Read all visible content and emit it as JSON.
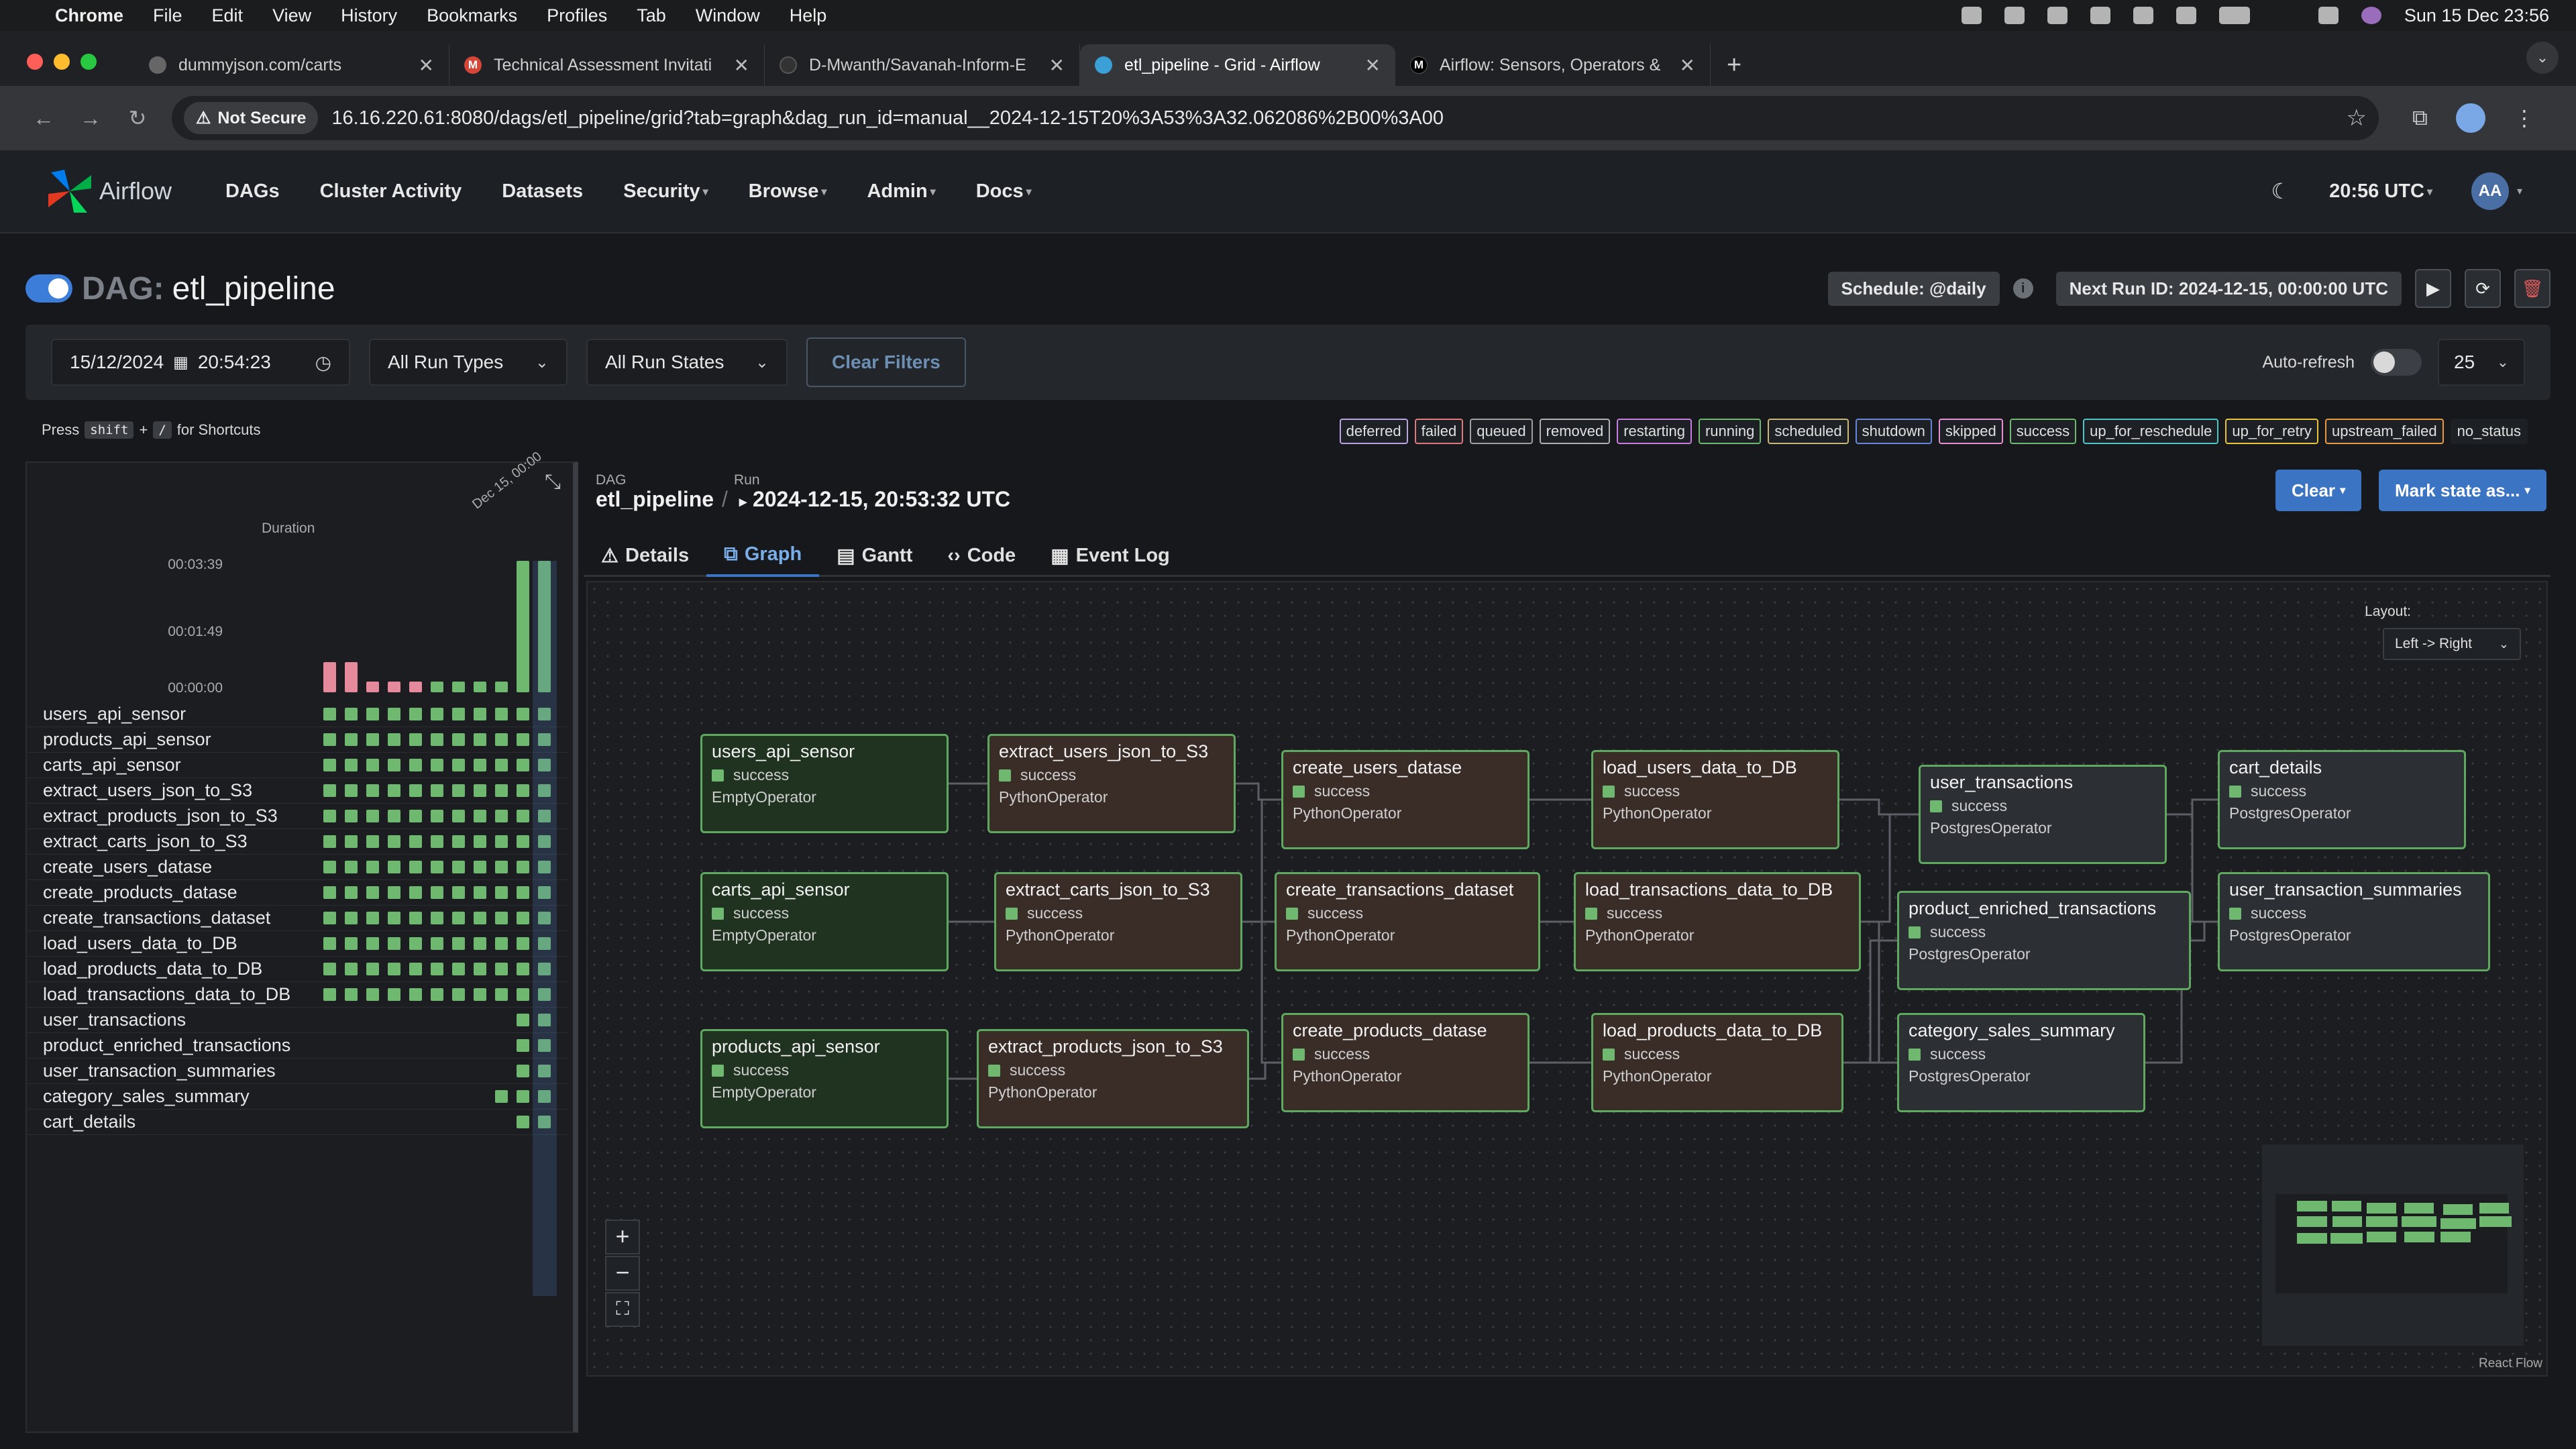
{
  "macbar": {
    "app": "Chrome",
    "menus": [
      "File",
      "Edit",
      "View",
      "History",
      "Bookmarks",
      "Profiles",
      "Tab",
      "Window",
      "Help"
    ],
    "clock": "Sun 15 Dec  23:56"
  },
  "tabs": [
    {
      "title": "dummyjson.com/carts",
      "icon": "globe-icon"
    },
    {
      "title": "Technical Assessment Invitati",
      "icon": "gmail-icon"
    },
    {
      "title": "D-Mwanth/Savanah-Inform-E",
      "icon": "github-icon"
    },
    {
      "title": "etl_pipeline - Grid - Airflow",
      "icon": "airflow-icon"
    },
    {
      "title": "Airflow: Sensors, Operators &",
      "icon": "medium-icon"
    }
  ],
  "address": {
    "security": "Not Secure",
    "url": "16.16.220.61:8080/dags/etl_pipeline/grid?tab=graph&dag_run_id=manual__2024-12-15T20%3A53%3A32.062086%2B00%3A00"
  },
  "nav": {
    "logo": "Airflow",
    "items": [
      "DAGs",
      "Cluster Activity",
      "Datasets",
      "Security",
      "Browse",
      "Admin",
      "Docs"
    ],
    "utc": "20:56 UTC",
    "avatar": "AA"
  },
  "dag": {
    "prefix": "DAG:",
    "name": "etl_pipeline",
    "schedule": "Schedule: @daily",
    "next_run": "Next Run ID: 2024-12-15, 00:00:00 UTC"
  },
  "filters": {
    "date": "15/12/2024",
    "time": "20:54:23",
    "run_types": "All Run Types",
    "run_states": "All Run States",
    "clear": "Clear Filters",
    "auto_refresh": "Auto-refresh",
    "page_size": "25"
  },
  "shortcuts": {
    "press": "Press",
    "key1": "shift",
    "plus": "+",
    "key2": "/",
    "suffix": "for Shortcuts"
  },
  "legend": [
    {
      "label": "deferred",
      "color": "#b9a3e3"
    },
    {
      "label": "failed",
      "color": "#e07a7a"
    },
    {
      "label": "queued",
      "color": "#a0a0a0"
    },
    {
      "label": "removed",
      "color": "#b0b0b0"
    },
    {
      "label": "restarting",
      "color": "#c77ddb"
    },
    {
      "label": "running",
      "color": "#6fb86f"
    },
    {
      "label": "scheduled",
      "color": "#c9b77a"
    },
    {
      "label": "shutdown",
      "color": "#6a86d9"
    },
    {
      "label": "skipped",
      "color": "#e78fd3"
    },
    {
      "label": "success",
      "color": "#6fb86f"
    },
    {
      "label": "up_for_reschedule",
      "color": "#4dc6c6"
    },
    {
      "label": "up_for_retry",
      "color": "#e8c33e"
    },
    {
      "label": "upstream_failed",
      "color": "#e89a40"
    },
    {
      "label": "no_status",
      "color": ""
    }
  ],
  "grid": {
    "duration_label": "Duration",
    "axis": [
      "00:03:39",
      "00:01:49",
      "00:00:00"
    ],
    "date_label": "Dec 15, 00:00",
    "tasks": [
      {
        "name": "users_api_sensor",
        "runs": 11
      },
      {
        "name": "products_api_sensor",
        "runs": 11
      },
      {
        "name": "carts_api_sensor",
        "runs": 11
      },
      {
        "name": "extract_users_json_to_S3",
        "runs": 11
      },
      {
        "name": "extract_products_json_to_S3",
        "runs": 11
      },
      {
        "name": "extract_carts_json_to_S3",
        "runs": 11
      },
      {
        "name": "create_users_datase",
        "runs": 11
      },
      {
        "name": "create_products_datase",
        "runs": 11
      },
      {
        "name": "create_transactions_dataset",
        "runs": 11
      },
      {
        "name": "load_users_data_to_DB",
        "runs": 11
      },
      {
        "name": "load_products_data_to_DB",
        "runs": 11
      },
      {
        "name": "load_transactions_data_to_DB",
        "runs": 11
      },
      {
        "name": "user_transactions",
        "runs": 2
      },
      {
        "name": "product_enriched_transactions",
        "runs": 2
      },
      {
        "name": "user_transaction_summaries",
        "runs": 2
      },
      {
        "name": "category_sales_summary",
        "runs": 3
      },
      {
        "name": "cart_details",
        "runs": 2
      }
    ],
    "run_durations": [
      {
        "state": "failed",
        "level": 0.23
      },
      {
        "state": "failed",
        "level": 0.23
      },
      {
        "state": "failed",
        "level": 0.08
      },
      {
        "state": "failed",
        "level": 0.08
      },
      {
        "state": "failed",
        "level": 0.08
      },
      {
        "state": "success",
        "level": 0.08
      },
      {
        "state": "success",
        "level": 0.08
      },
      {
        "state": "success",
        "level": 0.08
      },
      {
        "state": "success",
        "level": 0.08
      },
      {
        "state": "success",
        "level": 1.0
      },
      {
        "state": "success",
        "level": 1.0
      }
    ]
  },
  "run": {
    "dag_label": "DAG",
    "dag_value": "etl_pipeline",
    "run_label": "Run",
    "run_value": "2024-12-15, 20:53:32 UTC",
    "clear_btn": "Clear",
    "mark_btn": "Mark state as..."
  },
  "detail_tabs": [
    "Details",
    "Graph",
    "Gantt",
    "Code",
    "Event Log"
  ],
  "graph": {
    "layout_label": "Layout:",
    "layout_value": "Left -> Right",
    "react_flow": "React Flow",
    "nodes": [
      {
        "name": "users_api_sensor",
        "state": "success",
        "operator": "EmptyOperator"
      },
      {
        "name": "carts_api_sensor",
        "state": "success",
        "operator": "EmptyOperator"
      },
      {
        "name": "products_api_sensor",
        "state": "success",
        "operator": "EmptyOperator"
      },
      {
        "name": "extract_users_json_to_S3",
        "state": "success",
        "operator": "PythonOperator"
      },
      {
        "name": "extract_carts_json_to_S3",
        "state": "success",
        "operator": "PythonOperator"
      },
      {
        "name": "extract_products_json_to_S3",
        "state": "success",
        "operator": "PythonOperator"
      },
      {
        "name": "create_users_datase",
        "state": "success",
        "operator": "PythonOperator"
      },
      {
        "name": "create_transactions_dataset",
        "state": "success",
        "operator": "PythonOperator"
      },
      {
        "name": "create_products_datase",
        "state": "success",
        "operator": "PythonOperator"
      },
      {
        "name": "load_users_data_to_DB",
        "state": "success",
        "operator": "PythonOperator"
      },
      {
        "name": "load_transactions_data_to_DB",
        "state": "success",
        "operator": "PythonOperator"
      },
      {
        "name": "load_products_data_to_DB",
        "state": "success",
        "operator": "PythonOperator"
      },
      {
        "name": "user_transactions",
        "state": "success",
        "operator": "PostgresOperator"
      },
      {
        "name": "product_enriched_transactions",
        "state": "success",
        "operator": "PostgresOperator"
      },
      {
        "name": "category_sales_summary",
        "state": "success",
        "operator": "PostgresOperator"
      },
      {
        "name": "cart_details",
        "state": "success",
        "operator": "PostgresOperator"
      },
      {
        "name": "user_transaction_summaries",
        "state": "success",
        "operator": "PostgresOperator"
      }
    ]
  }
}
